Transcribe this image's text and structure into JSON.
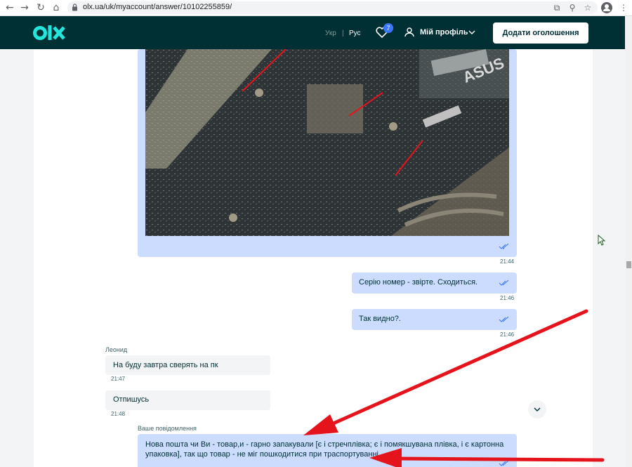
{
  "browser": {
    "url": "olx.ua/uk/myaccount/answer/10102255859/"
  },
  "header": {
    "lang_ukr": "Укр",
    "lang_sep": "|",
    "lang_rus": "Рус",
    "favorites_count": "7",
    "profile_label": "Мій профіль",
    "add_ad_label": "Додати оголошення"
  },
  "colors": {
    "header_bg": "#002f34",
    "logo_accent": "#23e5db",
    "outgoing_bubble": "#ccdcff",
    "incoming_bubble": "#f2f4f5",
    "badge": "#3a77ff",
    "annotation_arrow": "#e5141c"
  },
  "chat": {
    "messages": [
      {
        "type": "image",
        "direction": "out",
        "time": "21:44"
      },
      {
        "type": "text",
        "direction": "out",
        "text": "Серію номер - звірте. Сходиться.",
        "time": "21:46"
      },
      {
        "type": "text",
        "direction": "out",
        "text": "Так видно?.",
        "time": "21:46"
      },
      {
        "type": "text",
        "direction": "in",
        "sender": "Леонид",
        "text": "На буду завтра сверять на пк",
        "time": "21:47"
      },
      {
        "type": "text",
        "direction": "in",
        "text": "Отпишусь",
        "time": "21:48"
      },
      {
        "type": "text",
        "direction": "out",
        "sender": "Ваше повідомлення",
        "text_line1": "Нова пошта чи Ви - товар,и - гарно запакували [є і стречплівка; є і помякшувана плівка, і є картонна",
        "text_line2": "упаковка], так що товар - не міг пошкодитися при траспортуванні."
      }
    ]
  },
  "icons": {
    "back": "arrow-left-icon",
    "forward": "arrow-right-icon",
    "reload": "reload-icon",
    "home": "home-icon",
    "lock": "lock-icon",
    "heart": "heart-icon",
    "user": "user-icon",
    "read": "double-check-icon",
    "scroll_down": "chevron-down-icon"
  }
}
